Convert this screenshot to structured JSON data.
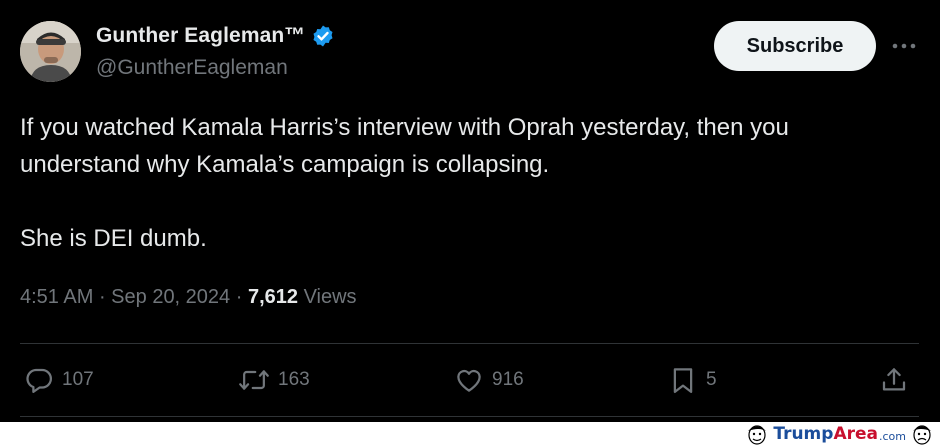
{
  "author": {
    "display_name": "Gunther Eagleman™",
    "handle": "@GuntherEagleman"
  },
  "subscribe_label": "Subscribe",
  "tweet": {
    "line1": "If you watched Kamala Harris’s interview with Oprah yesterday, then you",
    "line2": "understand why Kamala’s campaign is collapsing.",
    "line3": "She is DEI dumb."
  },
  "meta": {
    "time": "4:51 AM",
    "sep1": " · ",
    "date": "Sep 20, 2024",
    "sep2": " · ",
    "views_count": "7,612",
    "views_label": " Views"
  },
  "actions": {
    "replies": "107",
    "reposts": "163",
    "likes": "916",
    "bookmarks": "5"
  },
  "watermark": {
    "part1": "Trump",
    "part2": "Area",
    "part3": ".com"
  },
  "colors": {
    "background": "#000000",
    "text": "#e7e9ea",
    "secondary": "#71767b",
    "verified": "#1d9bf0"
  }
}
